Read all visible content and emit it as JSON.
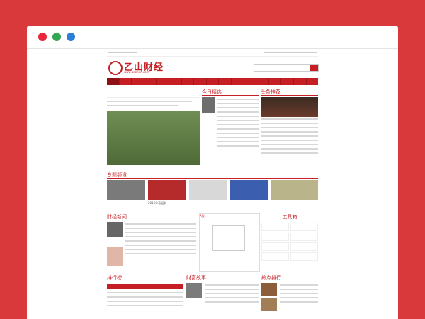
{
  "window": {
    "dots": [
      {
        "name": "close",
        "color": "#e8273a"
      },
      {
        "name": "minimize",
        "color": "#33a852"
      },
      {
        "name": "maximize",
        "color": "#2a7fd6"
      }
    ]
  },
  "site": {
    "brand": "乙山财经",
    "brand_url": "www.baohen.com",
    "accent": "#c51f24",
    "nav_items": [
      "首页",
      "",
      "",
      "",
      "",
      "",
      "",
      "",
      "",
      "",
      "",
      "",
      "",
      "",
      "",
      "",
      ""
    ],
    "headline": "",
    "sections": {
      "featured": "今日精选",
      "headlines": "头条推荐",
      "topics": "专题频道",
      "news": "财经新闻",
      "tools": "工具箱",
      "ranking": "排行榜",
      "stories": "财富故事",
      "hot": "热点排行"
    },
    "more_label": "更多",
    "tabs": [
      "A股",
      "",
      "",
      "",
      "",
      ""
    ],
    "topic_captions": [
      "",
      "2016年春运前",
      "",
      "",
      ""
    ]
  }
}
